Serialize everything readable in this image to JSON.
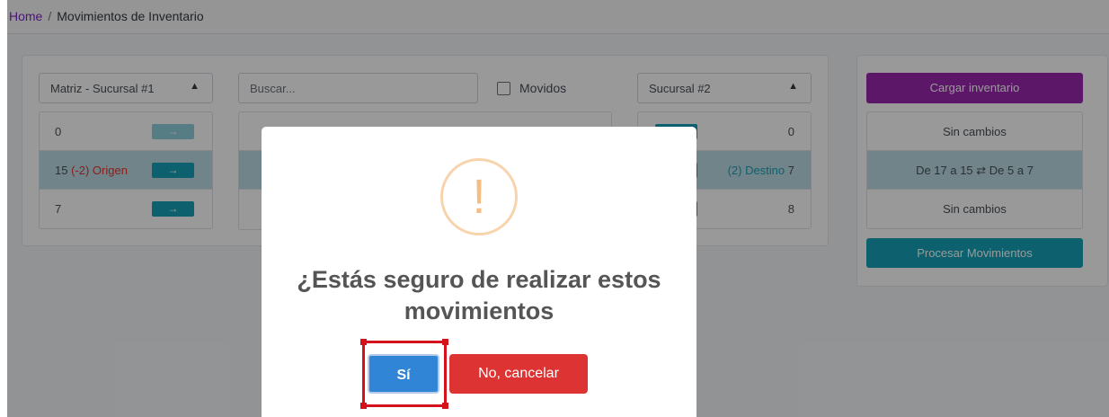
{
  "breadcrumb": {
    "home": "Home",
    "separator": "/",
    "current": "Movimientos de Inventario"
  },
  "filters": {
    "origin_select": "Matriz - Sucursal #1",
    "search_placeholder": "Buscar...",
    "moved_label": "Movidos",
    "dest_select": "Sucursal #2"
  },
  "origin_list": [
    {
      "value": "0",
      "arrow": "→"
    },
    {
      "value": "15",
      "change": "(-2) Origen",
      "arrow": "→"
    },
    {
      "value": "7",
      "arrow": "→"
    }
  ],
  "dest_list": [
    {
      "value": "0"
    },
    {
      "change": "(2) Destino",
      "value": "7"
    },
    {
      "value": "8"
    }
  ],
  "side": {
    "load_button": "Cargar inventario",
    "rows": [
      "Sin cambios",
      "De 17 a 15 ⇄ De 5 a 7",
      "Sin cambios"
    ],
    "process_button": "Procesar Movimientos"
  },
  "modal": {
    "icon_glyph": "!",
    "icon": "warning-icon",
    "title": "¿Estás seguro de realizar estos movimientos",
    "confirm_label": "Sí",
    "cancel_label": "No, cancelar"
  },
  "colors": {
    "accent_purple": "#9b27b0",
    "info": "#17a2b8",
    "confirm": "#3085d6",
    "cancel": "#dd3333",
    "highlight": "#d4121b"
  }
}
